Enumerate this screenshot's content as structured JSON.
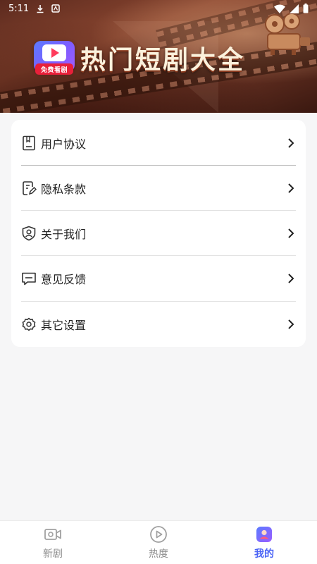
{
  "status_bar": {
    "time": "5:11"
  },
  "banner": {
    "title": "热门短剧大全",
    "logo_tag": "免费看剧"
  },
  "menu": {
    "items": [
      {
        "label": "用户协议",
        "icon": "book-icon"
      },
      {
        "label": "隐私条款",
        "icon": "document-edit-icon"
      },
      {
        "label": "关于我们",
        "icon": "shield-user-icon"
      },
      {
        "label": "意见反馈",
        "icon": "chat-bubble-icon"
      },
      {
        "label": "其它设置",
        "icon": "gear-icon"
      }
    ]
  },
  "tabs": [
    {
      "label": "新剧",
      "icon": "video-camera-icon",
      "active": false
    },
    {
      "label": "热度",
      "icon": "play-circle-icon",
      "active": false
    },
    {
      "label": "我的",
      "icon": "profile-icon",
      "active": true
    }
  ],
  "colors": {
    "accent": "#4a63f5",
    "banner_brown": "#6a3324",
    "logo_red": "#e8203a"
  }
}
